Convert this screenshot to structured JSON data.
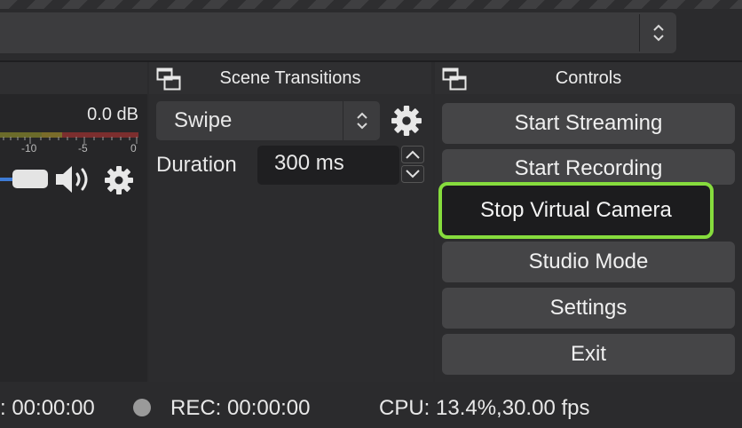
{
  "audio_mixer": {
    "volume_db": "0.0 dB",
    "meter_ticks": [
      "-10",
      "-5",
      "0"
    ]
  },
  "scene_transitions": {
    "title": "Scene Transitions",
    "transition": "Swipe",
    "duration_label": "Duration",
    "duration_value": "300 ms"
  },
  "controls": {
    "title": "Controls",
    "buttons": [
      "Start Streaming",
      "Start Recording",
      "Stop Virtual Camera",
      "Studio Mode",
      "Settings",
      "Exit"
    ]
  },
  "status_bar": {
    "live_time": ": 00:00:00",
    "rec": "REC: 00:00:00",
    "cpu": "CPU: 13.4%,30.00 fps"
  },
  "colors": {
    "highlight": "#86dc3d",
    "accent": "#3d7bd6"
  },
  "icons": [
    "dock-undock-icon",
    "gear-icon",
    "speaker-icon",
    "chevron-up-down-icon"
  ]
}
